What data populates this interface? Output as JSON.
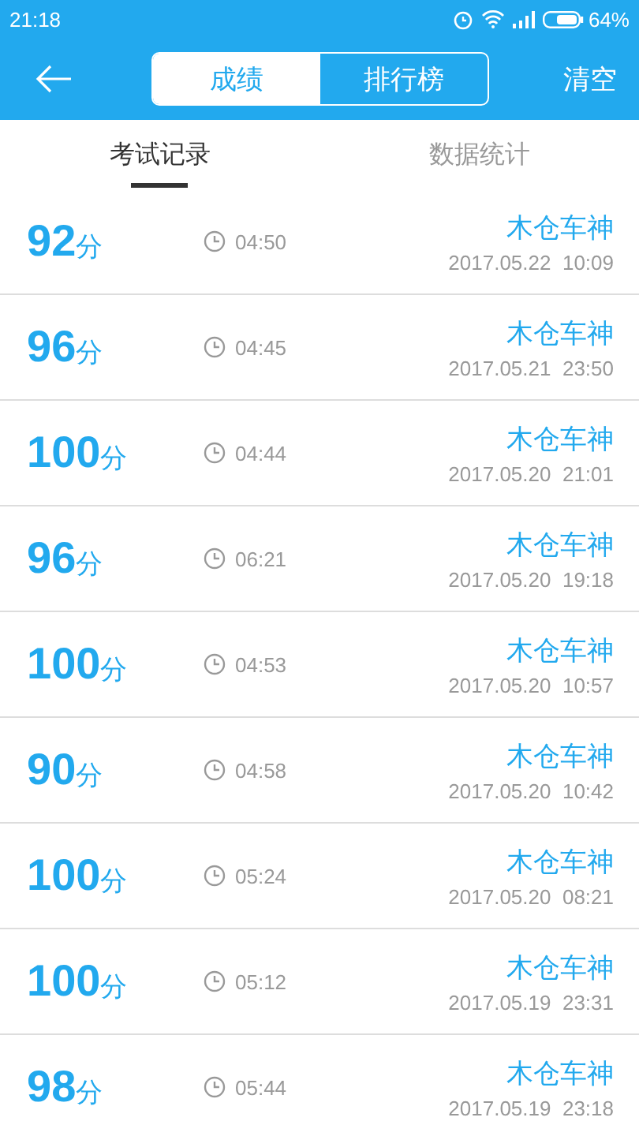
{
  "status_bar": {
    "time": "21:18",
    "battery": "64%"
  },
  "header": {
    "segments": [
      {
        "label": "成绩",
        "selected": true
      },
      {
        "label": "排行榜",
        "selected": false
      }
    ],
    "action": "清空"
  },
  "tabs": [
    {
      "label": "考试记录",
      "selected": true
    },
    {
      "label": "数据统计",
      "selected": false
    }
  ],
  "records": [
    {
      "score": "92",
      "unit": "分",
      "duration": "04:50",
      "name": "木仓车神",
      "date": "2017.05.22  10:09"
    },
    {
      "score": "96",
      "unit": "分",
      "duration": "04:45",
      "name": "木仓车神",
      "date": "2017.05.21  23:50"
    },
    {
      "score": "100",
      "unit": "分",
      "duration": "04:44",
      "name": "木仓车神",
      "date": "2017.05.20  21:01"
    },
    {
      "score": "96",
      "unit": "分",
      "duration": "06:21",
      "name": "木仓车神",
      "date": "2017.05.20  19:18"
    },
    {
      "score": "100",
      "unit": "分",
      "duration": "04:53",
      "name": "木仓车神",
      "date": "2017.05.20  10:57"
    },
    {
      "score": "90",
      "unit": "分",
      "duration": "04:58",
      "name": "木仓车神",
      "date": "2017.05.20  10:42"
    },
    {
      "score": "100",
      "unit": "分",
      "duration": "05:24",
      "name": "木仓车神",
      "date": "2017.05.20  08:21"
    },
    {
      "score": "100",
      "unit": "分",
      "duration": "05:12",
      "name": "木仓车神",
      "date": "2017.05.19  23:31"
    },
    {
      "score": "98",
      "unit": "分",
      "duration": "05:44",
      "name": "木仓车神",
      "date": "2017.05.19  23:18"
    }
  ]
}
